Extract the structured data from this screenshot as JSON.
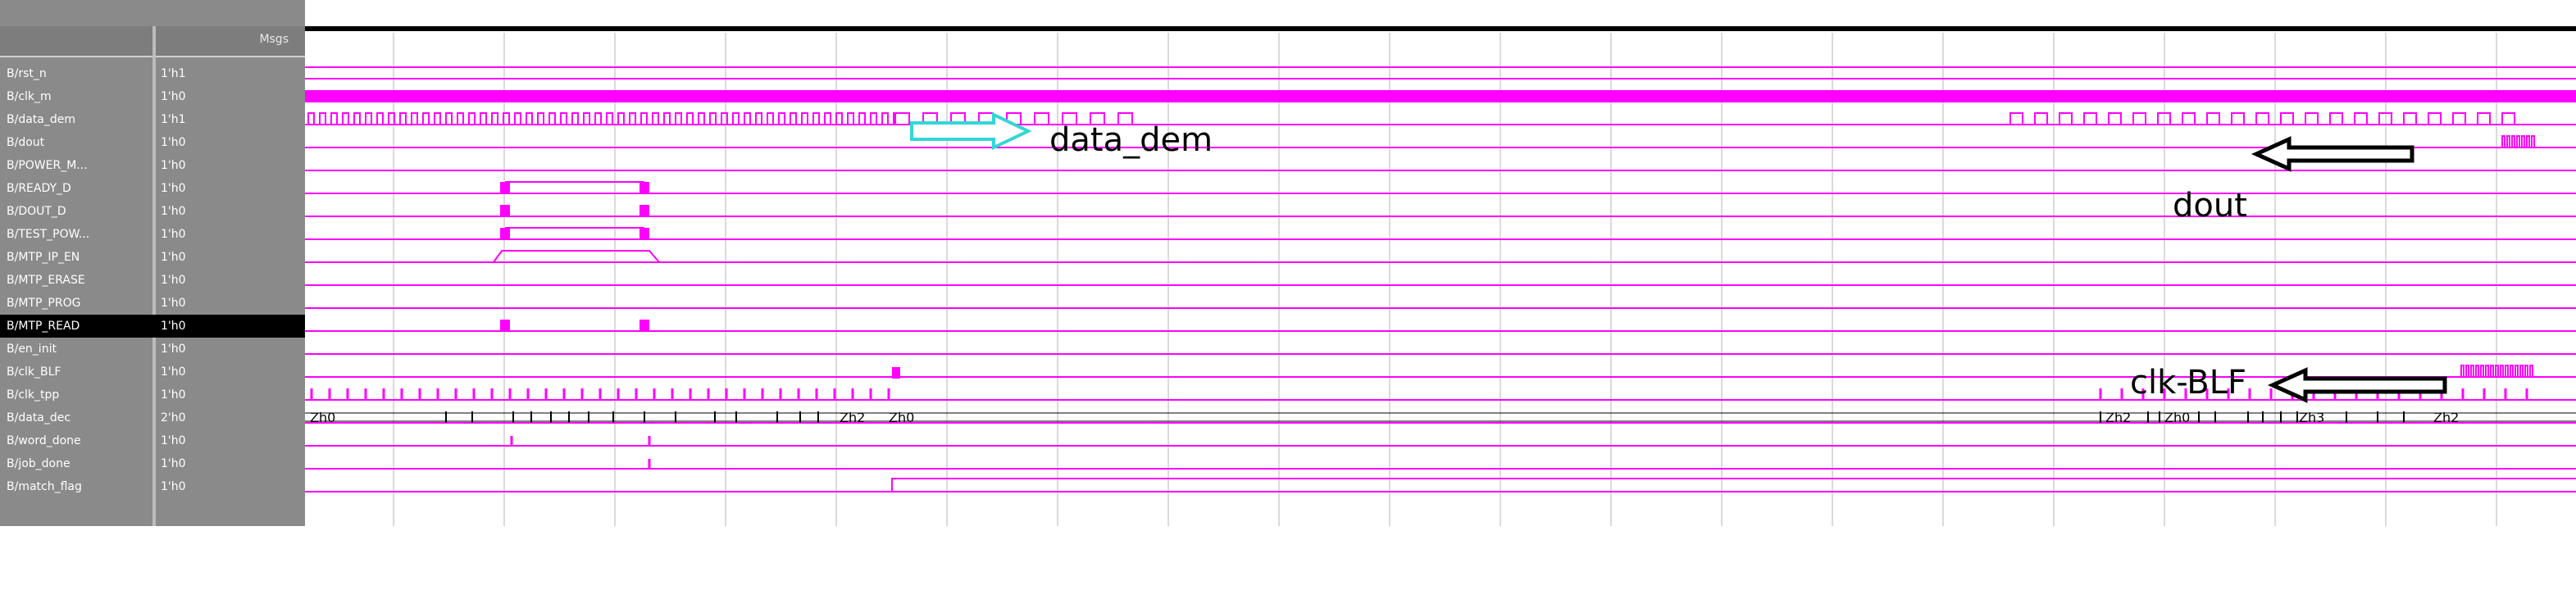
{
  "header": {
    "msgs_label": "Msgs"
  },
  "signals": [
    {
      "name": "B/rst_n",
      "value": "1'h1"
    },
    {
      "name": "B/clk_m",
      "value": "1'h0"
    },
    {
      "name": "B/data_dem",
      "value": "1'h1"
    },
    {
      "name": "B/dout",
      "value": "1'h0"
    },
    {
      "name": "B/POWER_M...",
      "value": "1'h0"
    },
    {
      "name": "B/READY_D",
      "value": "1'h0"
    },
    {
      "name": "B/DOUT_D",
      "value": "1'h0"
    },
    {
      "name": "B/TEST_POW...",
      "value": "1'h0"
    },
    {
      "name": "B/MTP_IP_EN",
      "value": "1'h0"
    },
    {
      "name": "B/MTP_ERASE",
      "value": "1'h0"
    },
    {
      "name": "B/MTP_PROG",
      "value": "1'h0"
    },
    {
      "name": "B/MTP_READ",
      "value": "1'h0",
      "selected": true
    },
    {
      "name": "B/en_init",
      "value": "1'h0"
    },
    {
      "name": "B/clk_BLF",
      "value": "1'h0"
    },
    {
      "name": "B/clk_tpp",
      "value": "1'h0"
    },
    {
      "name": "B/data_dec",
      "value": "2'h0"
    },
    {
      "name": "B/word_done",
      "value": "1'h0"
    },
    {
      "name": "B/job_done",
      "value": "1'h0"
    },
    {
      "name": "B/match_flag",
      "value": "1'h0"
    }
  ],
  "bus_labels": [
    "Zh0",
    "Zh2",
    "Zh0",
    "Zh2",
    "Zh0",
    "Zh3",
    "Zh2"
  ],
  "annotations": {
    "data_dem": "data_dem",
    "dout": "dout",
    "clk_blf": "clk-BLF"
  },
  "colors": {
    "wave": "#ff00ff",
    "grid": "#dadada",
    "panel": "#8a8a8a",
    "arrow_cyan": "#33d6d6",
    "arrow_black": "#000000"
  }
}
